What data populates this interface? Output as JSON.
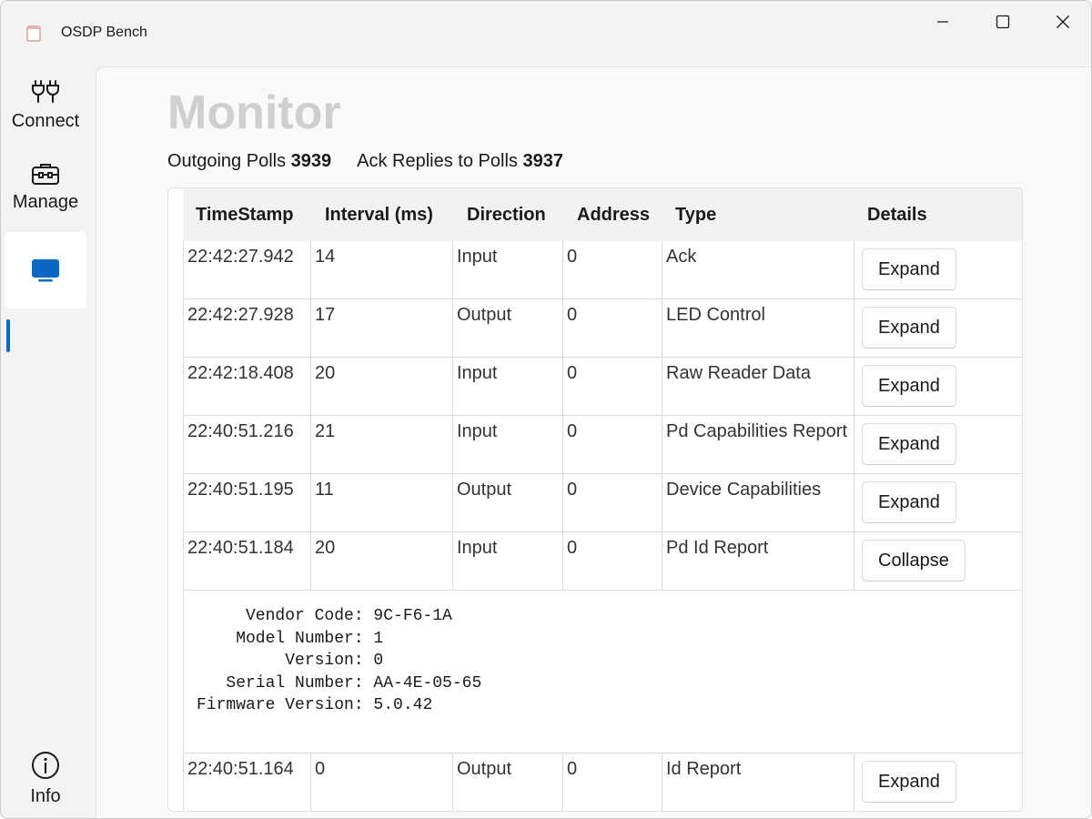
{
  "window": {
    "title": "OSDP Bench"
  },
  "nav": {
    "items": [
      {
        "label": "Connect",
        "icon": "plug-icon"
      },
      {
        "label": "Manage",
        "icon": "toolbox-icon"
      },
      {
        "label": "",
        "icon": "monitor-icon",
        "selected": true
      },
      {
        "label": "Info",
        "icon": "info-icon"
      }
    ]
  },
  "page": {
    "title": "Monitor",
    "outgoing_label": "Outgoing Polls",
    "outgoing_value": "3939",
    "ack_label": "Ack Replies to Polls",
    "ack_value": "3937"
  },
  "table": {
    "columns": [
      "TimeStamp",
      "Interval (ms)",
      "Direction",
      "Address",
      "Type",
      "Details"
    ],
    "rows": [
      {
        "timestamp": "22:42:27.942",
        "interval": "14",
        "direction": "Input",
        "address": "0",
        "type": "Ack",
        "button": "Expand"
      },
      {
        "timestamp": "22:42:27.928",
        "interval": "17",
        "direction": "Output",
        "address": "0",
        "type": "LED Control",
        "button": "Expand"
      },
      {
        "timestamp": "22:42:18.408",
        "interval": "20",
        "direction": "Input",
        "address": "0",
        "type": "Raw Reader Data",
        "button": "Expand"
      },
      {
        "timestamp": "22:40:51.216",
        "interval": "21",
        "direction": "Input",
        "address": "0",
        "type": "Pd Capabilities Report",
        "button": "Expand"
      },
      {
        "timestamp": "22:40:51.195",
        "interval": "11",
        "direction": "Output",
        "address": "0",
        "type": "Device Capabilities",
        "button": "Expand"
      },
      {
        "timestamp": "22:40:51.184",
        "interval": "20",
        "direction": "Input",
        "address": "0",
        "type": "Pd Id Report",
        "button": "Collapse"
      },
      {
        "timestamp": "22:40:51.164",
        "interval": "0",
        "direction": "Output",
        "address": "0",
        "type": "Id Report",
        "button": "Expand"
      }
    ],
    "expanded_details": "     Vendor Code: 9C-F6-1A\n    Model Number: 1\n         Version: 0\n   Serial Number: AA-4E-05-65\nFirmware Version: 5.0.42"
  },
  "colors": {
    "accent": "#0a67c2",
    "title_gray": "#cfcfcf"
  }
}
